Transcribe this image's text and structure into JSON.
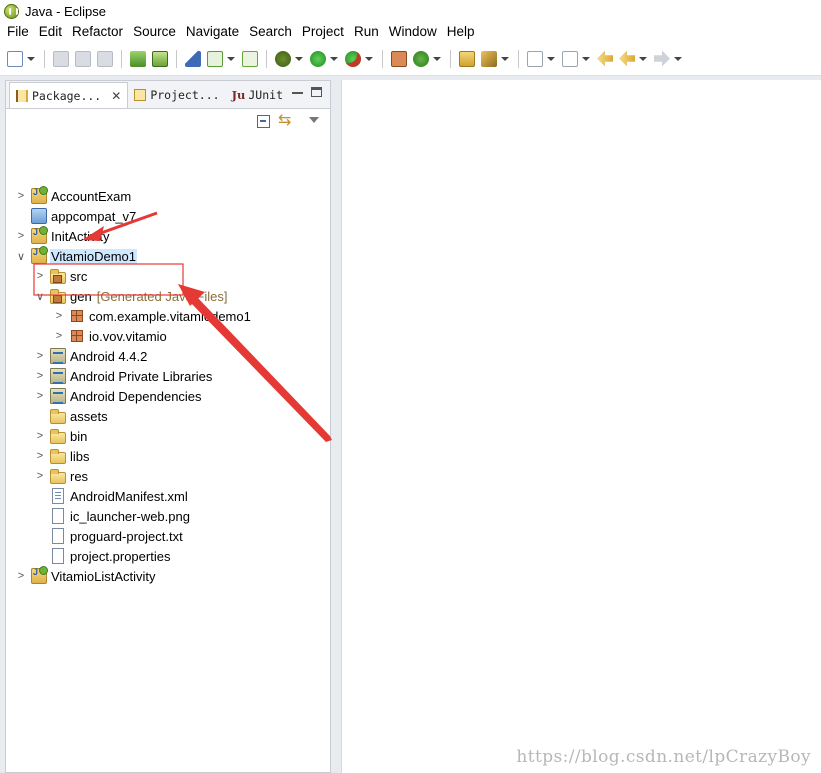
{
  "window": {
    "title": "Java - Eclipse"
  },
  "menu": [
    "File",
    "Edit",
    "Refactor",
    "Source",
    "Navigate",
    "Search",
    "Project",
    "Run",
    "Window",
    "Help"
  ],
  "toolbar_icons": [
    "new-icon",
    "save-icon",
    "save-all-icon",
    "print-icon",
    "download-sdk-icon",
    "avd-manager-icon",
    "lint-icon",
    "checklist-icon",
    "new-android-file-icon",
    "debug-icon",
    "run-icon",
    "run-external-icon",
    "new-java-package-icon",
    "new-java-class-icon",
    "open-type-icon",
    "search-icon",
    "next-annotation-icon",
    "previous-annotation-icon",
    "last-edit-icon",
    "back-icon",
    "forward-icon"
  ],
  "tabs": {
    "package_explorer": "Package...",
    "project_explorer": "Project...",
    "junit_prefix": "Ju",
    "junit": "JUnit",
    "close": "✕"
  },
  "tree": [
    {
      "label": "AccountExam",
      "expanded": false
    },
    {
      "label": "appcompat_v7",
      "expanded": false
    },
    {
      "label": "InitActivity",
      "expanded": false
    },
    {
      "label": "VitamioDemo1",
      "expanded": true,
      "selected": true
    },
    {
      "label": "src",
      "expanded": false
    },
    {
      "label": "gen",
      "decoration": "[Generated Java Files]",
      "expanded": true
    },
    {
      "label": "com.example.vitamiodemo1",
      "expanded": false
    },
    {
      "label": "io.vov.vitamio",
      "expanded": false
    },
    {
      "label": "Android 4.4.2",
      "expanded": false
    },
    {
      "label": "Android Private Libraries",
      "expanded": false
    },
    {
      "label": "Android Dependencies",
      "expanded": false
    },
    {
      "label": "assets"
    },
    {
      "label": "bin",
      "expanded": false
    },
    {
      "label": "libs",
      "expanded": false
    },
    {
      "label": "res",
      "expanded": false
    },
    {
      "label": "AndroidManifest.xml"
    },
    {
      "label": "ic_launcher-web.png"
    },
    {
      "label": "proguard-project.txt"
    },
    {
      "label": "project.properties"
    },
    {
      "label": "VitamioListActivity",
      "expanded": false
    }
  ],
  "watermark": "https://blog.csdn.net/lpCrazyBoy",
  "colors": {
    "annotation": "#e53935",
    "selection": "#cde8ff",
    "decoration": "#8a6d3b"
  }
}
